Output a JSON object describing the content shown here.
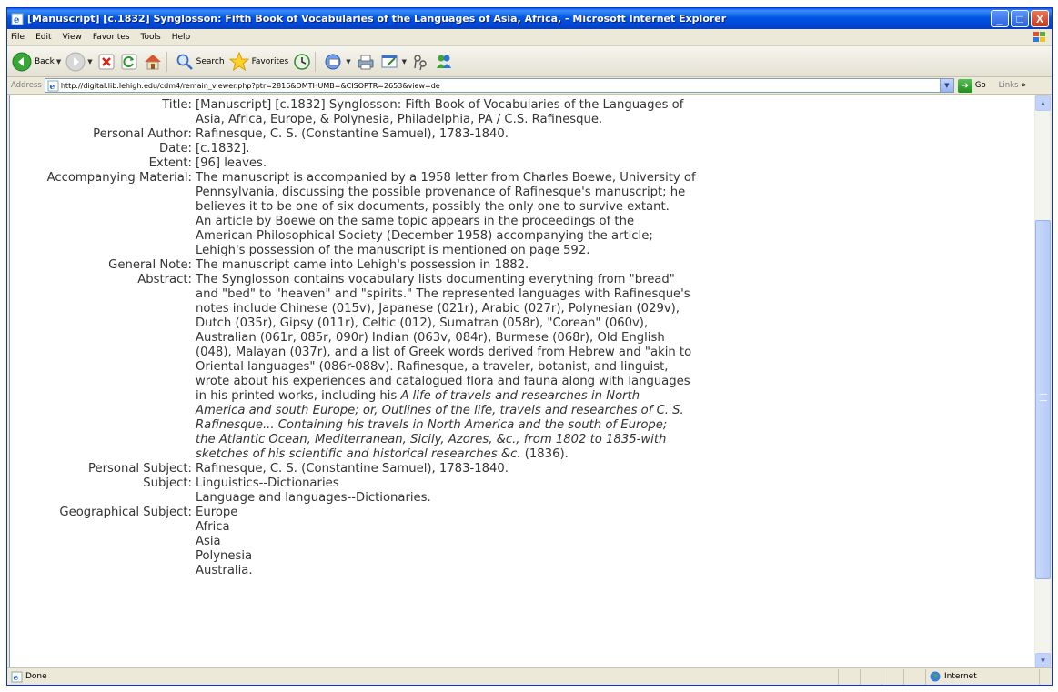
{
  "window": {
    "title": "[Manuscript] [c.1832] Synglosson: Fifth Book of Vocabularies of the Languages of Asia, Africa,  - Microsoft Internet Explorer",
    "buttons": {
      "minimize": "_",
      "maximize": "□",
      "close": "X"
    }
  },
  "menu": [
    "File",
    "Edit",
    "View",
    "Favorites",
    "Tools",
    "Help"
  ],
  "toolbar": {
    "back_label": "Back",
    "search_label": "Search",
    "favorites_label": "Favorites"
  },
  "address": {
    "label": "Address",
    "url": "http://digital.lib.lehigh.edu/cdm4/remain_viewer.php?ptr=2816&DMTHUMB=&CISOPTR=2653&view=de",
    "go_label": "Go",
    "links_label": "Links",
    "links_more": "»"
  },
  "record": {
    "title_label": "Title:",
    "title_lines": [
      "[Manuscript] [c.1832] Synglosson: Fifth Book of Vocabularies of the Languages of",
      "Asia, Africa, Europe, & Polynesia, Philadelphia, PA / C.S. Rafinesque."
    ],
    "author_label": "Personal Author:",
    "author": "Rafinesque, C. S. (Constantine Samuel), 1783-1840.",
    "date_label": "Date:",
    "date": "[c.1832].",
    "extent_label": "Extent:",
    "extent": "[96] leaves.",
    "accompanying_label": "Accompanying Material:",
    "accompanying_lines": [
      "The manuscript is accompanied by a 1958 letter from Charles Boewe, University of",
      "Pennsylvania, discussing the possible provenance of Rafinesque's manuscript; he",
      "believes it to be one of six documents, possibly the only one to survive extant.",
      "An article by Boewe on the same topic appears in the proceedings of the",
      "American Philosophical Society (December 1958) accompanying the article;",
      "Lehigh's possession of the manuscript is mentioned on page 592."
    ],
    "general_note_label": "General Note:",
    "general_note": "The manuscript came into Lehigh's possession in 1882.",
    "abstract_label": "Abstract:",
    "abstract_lines": [
      "The Synglosson contains vocabulary lists documenting everything from \"bread\"",
      "and \"bed\" to \"heaven\" and \"spirits.\" The represented languages with Rafinesque's",
      "notes include Chinese (015v), Japanese (021r), Arabic (027r), Polynesian (029v),",
      "Dutch (035r), Gipsy (011r), Celtic (012), Sumatran (058r), \"Corean\" (060v),",
      "Australian (061r, 085r, 090r) Indian (063v, 084r), Burmese (068r), Old English",
      "(048), Malayan (037r), and a list of Greek words derived from Hebrew and \"akin to",
      "Oriental languages\" (086r-088v). Rafinesque, a traveler, botanist, and linguist,",
      "wrote about his experiences and catalogued flora and fauna along with languages",
      "in his printed works, including his "
    ],
    "abstract_italic_1": "A life of travels and researches in North",
    "abstract_italic_lines": [
      "America and south Europe; or, Outlines of the life, travels and researches of C. S.",
      "Rafinesque... Containing his travels in North America and the south of Europe;",
      "the Atlantic Ocean, Mediterranean, Sicily, Azores, &c., from 1802 to 1835-with"
    ],
    "abstract_italic_last": "sketches of his scientific and historical researches &c.",
    "abstract_tail": " (1836).",
    "personal_subject_label": "Personal Subject:",
    "personal_subject": "Rafinesque, C. S. (Constantine Samuel), 1783-1840.",
    "subject_label": "Subject:",
    "subject_lines": [
      "Linguistics--Dictionaries",
      "Language and languages--Dictionaries."
    ],
    "geo_label": "Geographical Subject:",
    "geo_lines": [
      "Europe",
      "Africa",
      "Asia",
      "Polynesia",
      "Australia."
    ]
  },
  "status": {
    "text": "Done",
    "zone": "Internet"
  },
  "colors": {
    "titlebar": "#0055e5",
    "text": "#333333",
    "background": "#ffffff"
  },
  "icons": [
    "ie-page-icon",
    "back-arrow-icon",
    "forward-arrow-icon",
    "stop-icon",
    "refresh-icon",
    "home-icon",
    "search-icon",
    "favorites-star-icon",
    "history-icon",
    "mail-icon",
    "print-icon",
    "edit-icon",
    "discuss-icon",
    "messenger-icon",
    "go-arrow-icon",
    "globe-icon"
  ]
}
